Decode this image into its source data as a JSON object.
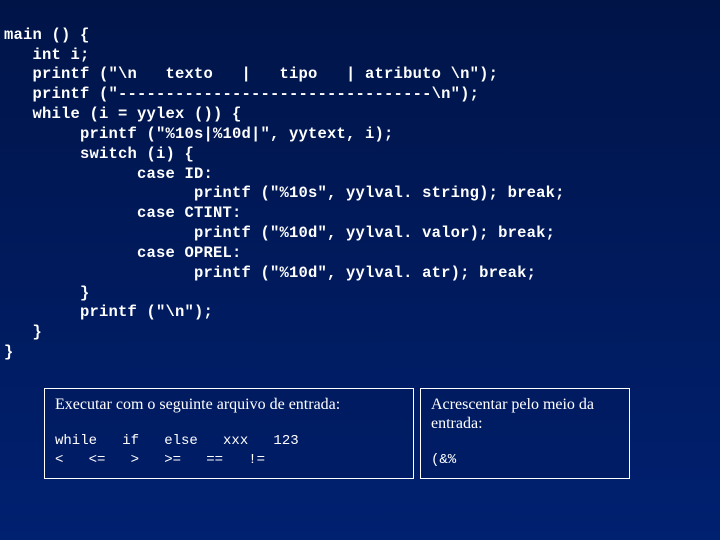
{
  "code": {
    "l01": "main () {",
    "l02": "   int i;",
    "l03": "   printf (\"\\n   texto   |   tipo   | atributo \\n\");",
    "l04": "   printf (\"---------------------------------\\n\");",
    "l05": "   while (i = yylex ()) {",
    "l06": "        printf (\"%10s|%10d|\", yytext, i);",
    "l07": "        switch (i) {",
    "l08": "              case ID:",
    "l09": "                    printf (\"%10s\", yylval. string); break;",
    "l10": "              case CTINT:",
    "l11": "                    printf (\"%10d\", yylval. valor); break;",
    "l12": "              case OPREL:",
    "l13": "                    printf (\"%10d\", yylval. atr); break;",
    "l14": "        }",
    "l15": "        printf (\"\\n\");",
    "l16": "   }",
    "l17": "}"
  },
  "leftbox": {
    "title": "Executar com o seguinte arquivo de entrada:",
    "line1": "while   if   else   xxx   123",
    "line2": "<   <=   >   >=   ==   !="
  },
  "rightbox": {
    "title": "Acrescentar pelo meio da entrada:",
    "line1": "(&%"
  }
}
